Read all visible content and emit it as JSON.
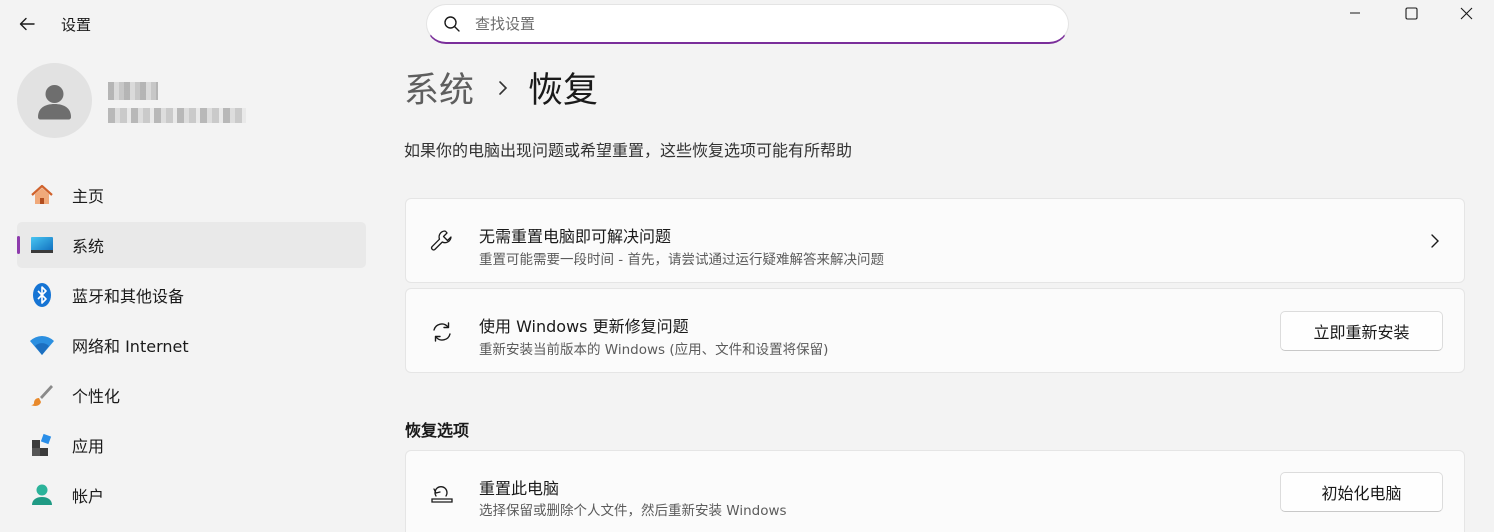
{
  "window": {
    "title": "设置"
  },
  "search": {
    "placeholder": "查找设置"
  },
  "sidebar": {
    "items": [
      {
        "label": "主页",
        "icon": "home-icon"
      },
      {
        "label": "系统",
        "icon": "system-icon",
        "active": true
      },
      {
        "label": "蓝牙和其他设备",
        "icon": "bluetooth-icon"
      },
      {
        "label": "网络和 Internet",
        "icon": "wifi-icon"
      },
      {
        "label": "个性化",
        "icon": "brush-icon"
      },
      {
        "label": "应用",
        "icon": "apps-icon"
      },
      {
        "label": "帐户",
        "icon": "account-icon"
      }
    ]
  },
  "main": {
    "breadcrumb_parent": "系统",
    "breadcrumb_current": "恢复",
    "description": "如果你的电脑出现问题或希望重置，这些恢复选项可能有所帮助",
    "cards": [
      {
        "title": "无需重置电脑即可解决问题",
        "subtitle": "重置可能需要一段时间 - 首先，请尝试通过运行疑难解答来解决问题",
        "icon": "wrench-icon"
      },
      {
        "title": "使用 Windows 更新修复问题",
        "subtitle": "重新安装当前版本的 Windows (应用、文件和设置将保留)",
        "button": "立即重新安装",
        "icon": "sync-icon"
      }
    ],
    "section_title": "恢复选项",
    "options": [
      {
        "title": "重置此电脑",
        "subtitle": "选择保留或删除个人文件，然后重新安装 Windows",
        "button": "初始化电脑",
        "icon": "reset-pc-icon"
      }
    ]
  },
  "colors": {
    "accent": "#8e3cad",
    "background": "#f3f3f3",
    "card": "#fbfbfb"
  }
}
